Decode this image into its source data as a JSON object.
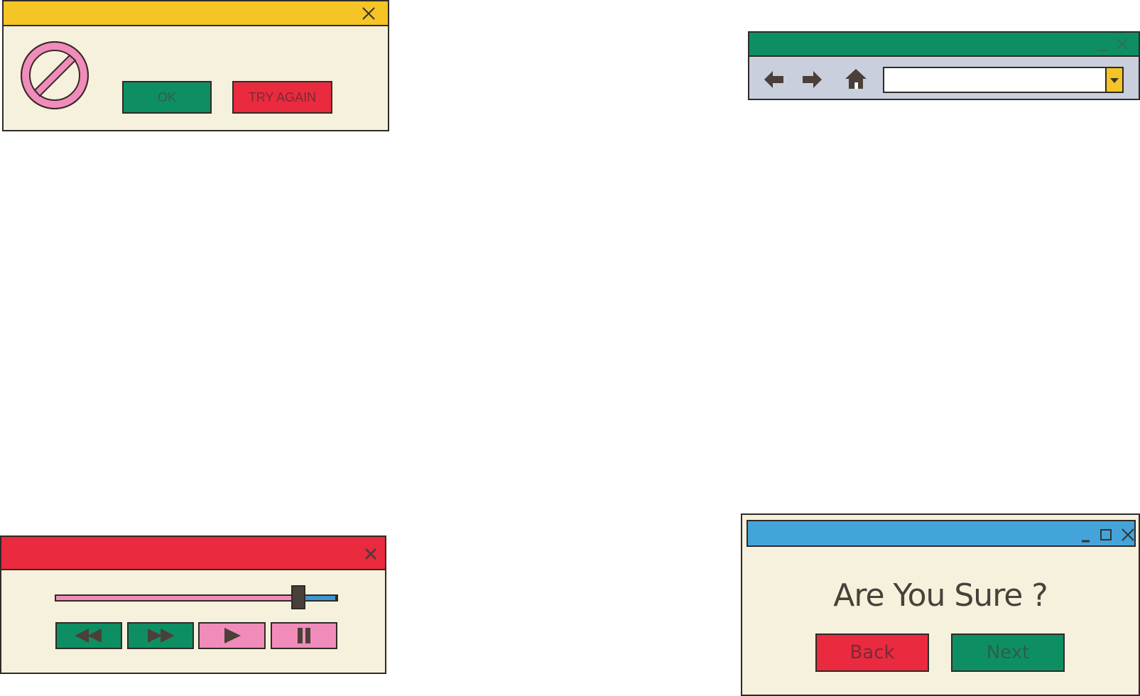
{
  "error_dialog": {
    "title_color": "#f5c425",
    "icon": "prohibited-icon",
    "close_icon": "close-icon",
    "ok_label": "OK",
    "try_again_label": "TRY AGAIN"
  },
  "browser": {
    "title_color": "#0e8f63",
    "minimize_icon": "minimize-icon",
    "close_icon": "close-icon",
    "back_icon": "arrow-left-icon",
    "forward_icon": "arrow-right-icon",
    "home_icon": "home-icon",
    "address_value": "",
    "address_placeholder": "",
    "dropdown_icon": "caret-down-icon"
  },
  "media_player": {
    "title_color": "#ea2a3f",
    "close_icon": "close-icon",
    "progress_percent": 86,
    "buttons": [
      {
        "name": "rewind",
        "icon": "rewind-icon"
      },
      {
        "name": "fast-forward",
        "icon": "fast-forward-icon"
      },
      {
        "name": "play",
        "icon": "play-icon"
      },
      {
        "name": "pause",
        "icon": "pause-icon"
      }
    ]
  },
  "confirm_dialog": {
    "title_color": "#43a4da",
    "message": "Are You Sure ?",
    "back_label": "Back",
    "next_label": "Next",
    "minimize_icon": "minimize-icon",
    "maximize_icon": "maximize-icon",
    "close_icon": "close-icon"
  },
  "colors": {
    "panel_bg": "#f6f1dc",
    "green": "#0e8f63",
    "red": "#ea2a3f",
    "pink": "#f08cba",
    "blue": "#43a4da",
    "yellow": "#f5c425",
    "toolbar_bg": "#c9cfdd",
    "ink": "#2f2b27"
  }
}
